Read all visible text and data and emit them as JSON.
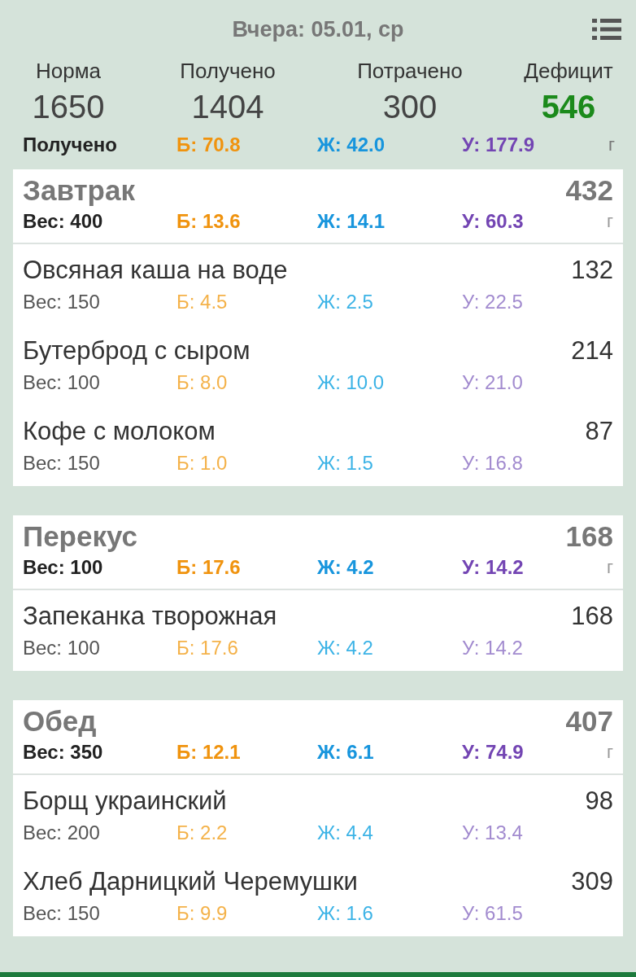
{
  "header": {
    "title": "Вчера: 05.01, ср"
  },
  "stats": [
    {
      "label": "Норма",
      "value": "1650",
      "kind": "plain"
    },
    {
      "label": "Получено",
      "value": "1404",
      "kind": "plain"
    },
    {
      "label": "Потрачено",
      "value": "300",
      "kind": "plain"
    },
    {
      "label": "Дефицит",
      "value": "546",
      "kind": "deficit"
    }
  ],
  "totals": {
    "label": "Получено",
    "protein": "Б: 70.8",
    "fat": "Ж: 42.0",
    "carbs": "У: 177.9",
    "unit": "г"
  },
  "meals": [
    {
      "name": "Завтрак",
      "kcal": "432",
      "weight": "Вес: 400",
      "protein": "Б: 13.6",
      "fat": "Ж: 14.1",
      "carbs": "У: 60.3",
      "unit": "г",
      "items": [
        {
          "name": "Овсяная каша на воде",
          "kcal": "132",
          "weight": "Вес: 150",
          "protein": "Б: 4.5",
          "fat": "Ж: 2.5",
          "carbs": "У: 22.5"
        },
        {
          "name": "Бутерброд с сыром",
          "kcal": "214",
          "weight": "Вес: 100",
          "protein": "Б: 8.0",
          "fat": "Ж: 10.0",
          "carbs": "У: 21.0"
        },
        {
          "name": "Кофе с молоком",
          "kcal": "87",
          "weight": "Вес: 150",
          "protein": "Б: 1.0",
          "fat": "Ж: 1.5",
          "carbs": "У: 16.8"
        }
      ]
    },
    {
      "name": "Перекус",
      "kcal": "168",
      "weight": "Вес: 100",
      "protein": "Б: 17.6",
      "fat": "Ж: 4.2",
      "carbs": "У: 14.2",
      "unit": "г",
      "items": [
        {
          "name": "Запеканка творожная",
          "kcal": "168",
          "weight": "Вес: 100",
          "protein": "Б: 17.6",
          "fat": "Ж: 4.2",
          "carbs": "У: 14.2"
        }
      ]
    },
    {
      "name": "Обед",
      "kcal": "407",
      "weight": "Вес: 350",
      "protein": "Б: 12.1",
      "fat": "Ж: 6.1",
      "carbs": "У: 74.9",
      "unit": "г",
      "items": [
        {
          "name": "Борщ украинский",
          "kcal": "98",
          "weight": "Вес: 200",
          "protein": "Б: 2.2",
          "fat": "Ж: 4.4",
          "carbs": "У: 13.4"
        },
        {
          "name": "Хлеб Дарницкий Черемушки",
          "kcal": "309",
          "weight": "Вес: 150",
          "protein": "Б: 9.9",
          "fat": "Ж: 1.6",
          "carbs": "У: 61.5"
        }
      ]
    }
  ]
}
